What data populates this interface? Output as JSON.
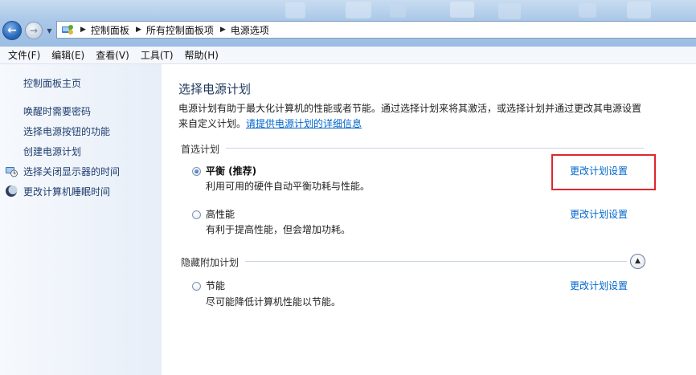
{
  "breadcrumbs": [
    "控制面板",
    "所有控制面板项",
    "电源选项"
  ],
  "menu": [
    "文件(F)",
    "编辑(E)",
    "查看(V)",
    "工具(T)",
    "帮助(H)"
  ],
  "sidebar": {
    "home": "控制面板主页",
    "links": [
      "唤醒时需要密码",
      "选择电源按钮的功能",
      "创建电源计划",
      "选择关闭显示器的时间",
      "更改计算机睡眠时间"
    ]
  },
  "main": {
    "title": "选择电源计划",
    "description": "电源计划有助于最大化计算机的性能或者节能。通过选择计划来将其激活，或选择计划并通过更改其电源设置来自定义计划。",
    "description_link": "请提供电源计划的详细信息",
    "preferred_label": "首选计划",
    "hidden_label": "隐藏附加计划",
    "plans": [
      {
        "name": "平衡 (推荐)",
        "desc": "利用可用的硬件自动平衡功耗与性能。",
        "link": "更改计划设置",
        "selected": true
      },
      {
        "name": "高性能",
        "desc": "有利于提高性能，但会增加功耗。",
        "link": "更改计划设置",
        "selected": false
      },
      {
        "name": "节能",
        "desc": "尽可能降低计算机性能以节能。",
        "link": "更改计划设置",
        "selected": false
      }
    ]
  },
  "colors": {
    "link": "#0066cc",
    "title": "#1e395b",
    "highlight": "#e0262f",
    "sidebar_link": "#1e3d6e"
  }
}
